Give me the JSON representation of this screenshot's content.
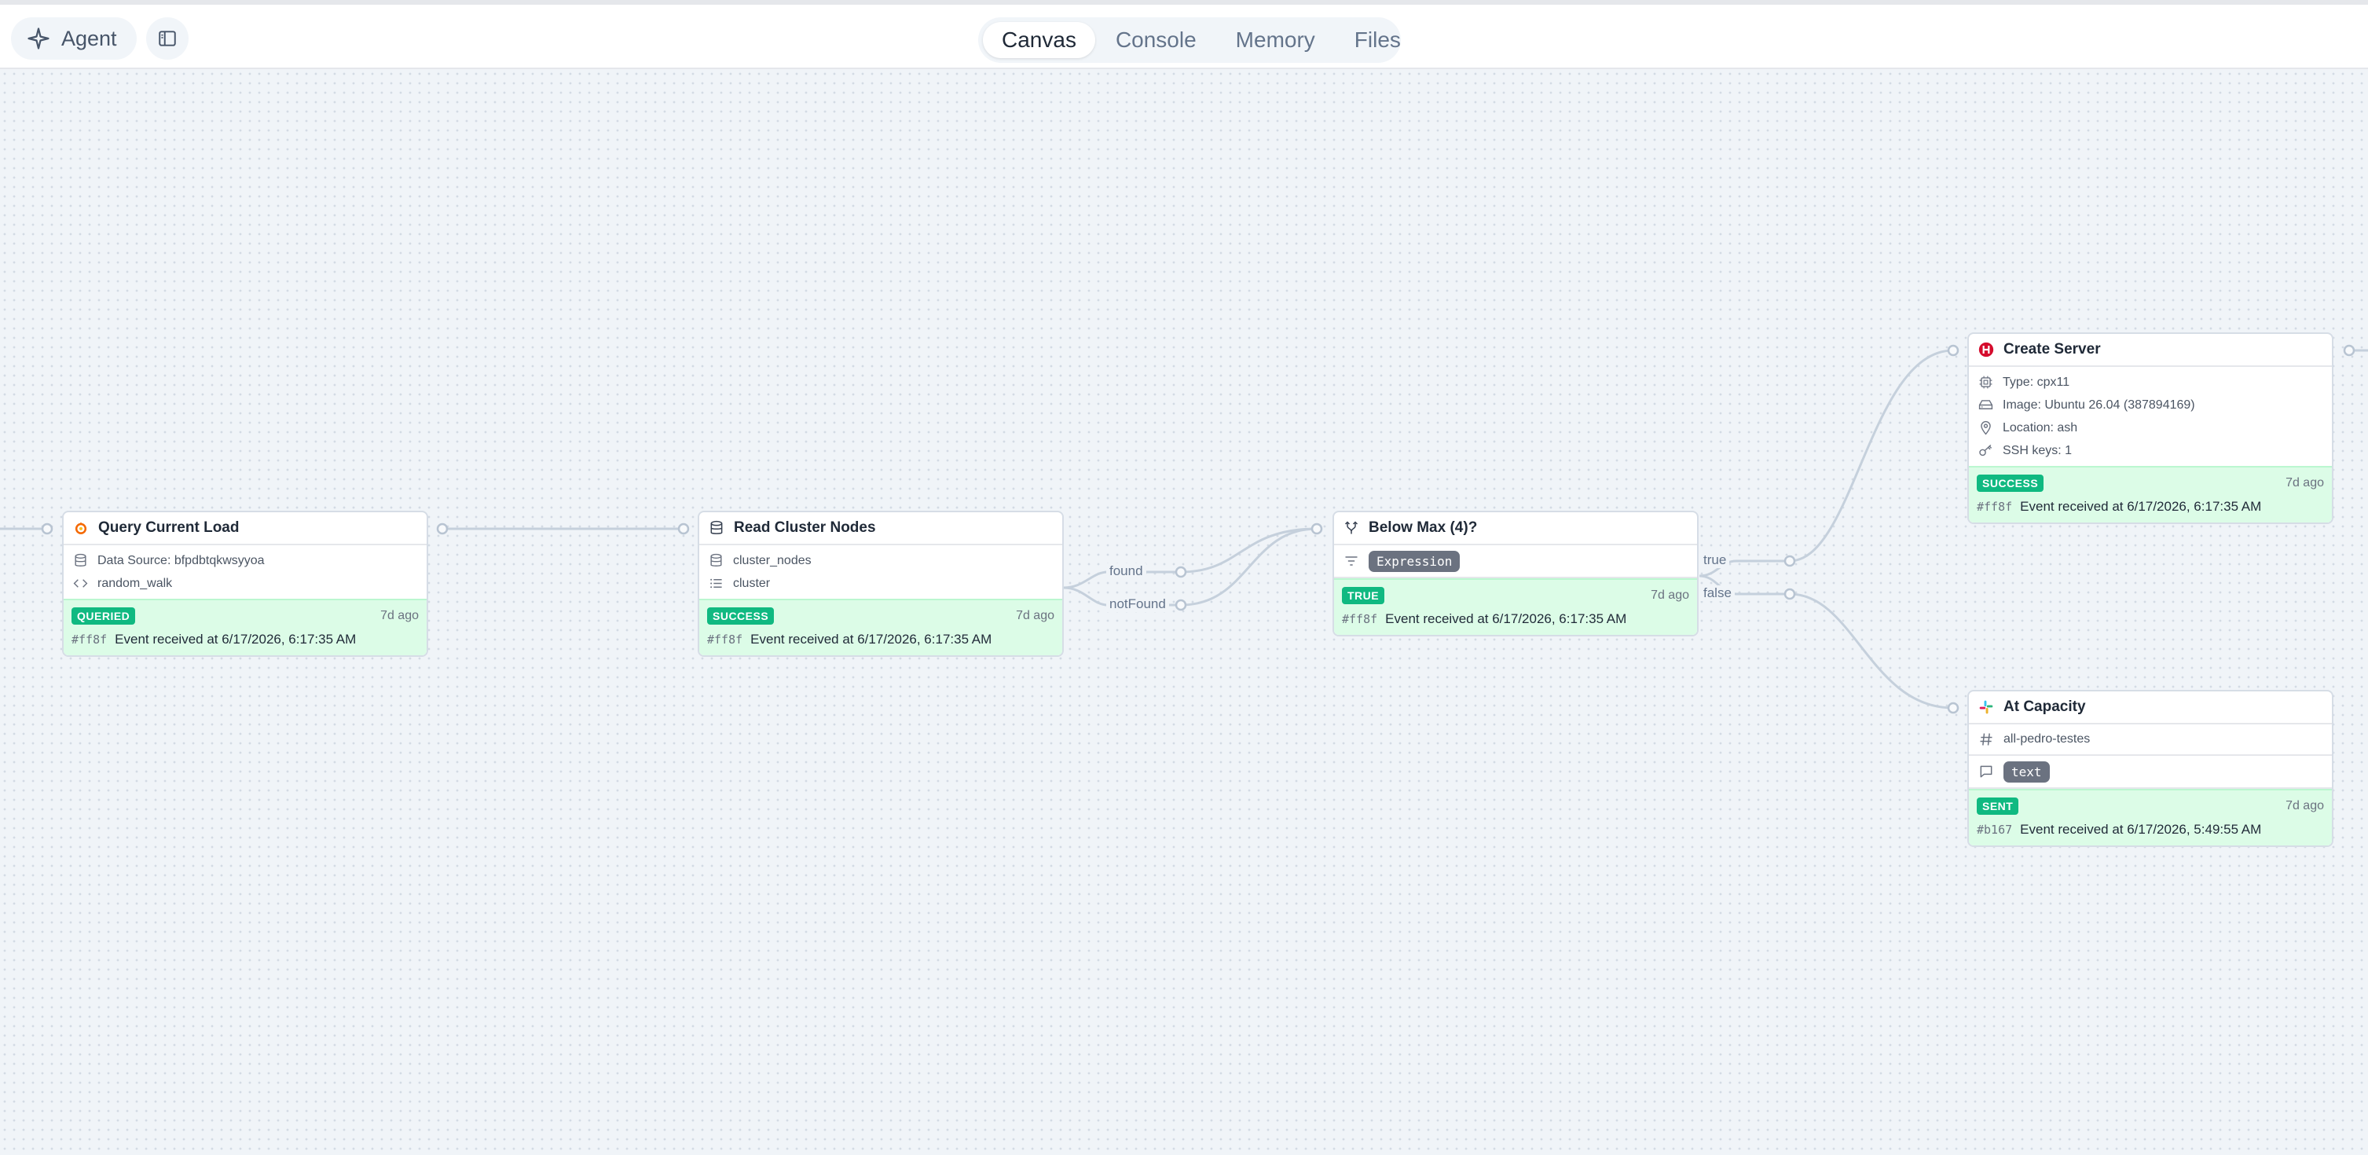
{
  "topbar": {
    "agent_label": "Agent",
    "tabs": [
      {
        "label": "Canvas",
        "active": true
      },
      {
        "label": "Console",
        "active": false
      },
      {
        "label": "Memory",
        "active": false
      },
      {
        "label": "Files",
        "active": false
      }
    ]
  },
  "edges": {
    "found_label": "found",
    "notfound_label": "notFound",
    "true_label": "true",
    "false_label": "false"
  },
  "nodes": {
    "query_load": {
      "title": "Query Current Load",
      "icon": "grafana-icon",
      "props": [
        "Data Source: bfpdbtqkwsyyoa",
        "random_walk"
      ],
      "status": "QUERIED",
      "ago": "7d ago",
      "hash": "#ff8f",
      "event": "Event received at 6/17/2026, 6:17:35 AM"
    },
    "read_nodes": {
      "title": "Read Cluster Nodes",
      "icon": "database-icon",
      "props": [
        "cluster_nodes",
        "cluster"
      ],
      "status": "SUCCESS",
      "ago": "7d ago",
      "hash": "#ff8f",
      "event": "Event received at 6/17/2026, 6:17:35 AM"
    },
    "below_max": {
      "title": "Below Max (4)?",
      "icon": "branch-icon",
      "pill": "Expression",
      "status": "TRUE",
      "ago": "7d ago",
      "hash": "#ff8f",
      "event": "Event received at 6/17/2026, 6:17:35 AM"
    },
    "create_server": {
      "title": "Create Server",
      "icon": "hetzner-icon",
      "props": [
        "Type: cpx11",
        "Image: Ubuntu 26.04 (387894169)",
        "Location: ash",
        "SSH keys: 1"
      ],
      "status": "SUCCESS",
      "ago": "7d ago",
      "hash": "#ff8f",
      "event": "Event received at 6/17/2026, 6:17:35 AM"
    },
    "at_capacity": {
      "title": "At Capacity",
      "icon": "slack-icon",
      "channel": "all-pedro-testes",
      "pill": "text",
      "status": "SENT",
      "ago": "7d ago",
      "hash": "#b167",
      "event": "Event received at 6/17/2026, 5:49:55 AM"
    }
  },
  "colors": {
    "status_bg": "#dcfce7",
    "badge": "#10b981",
    "hetzner": "#d50c2d"
  }
}
